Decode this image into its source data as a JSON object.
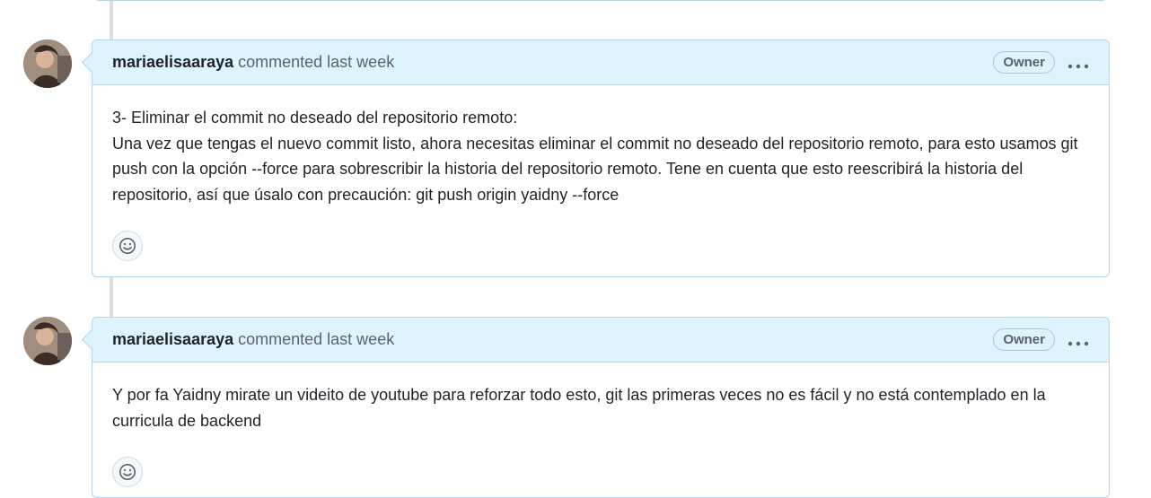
{
  "comments": [
    {
      "author": "mariaelisaaraya",
      "meta": "commented last week",
      "badge": "Owner",
      "menu_icon": "kebab-horizontal-icon",
      "body_lines": [
        "3- Eliminar el commit no deseado del repositorio remoto:",
        "Una vez que tengas el nuevo commit listo, ahora necesitas eliminar el commit no deseado del repositorio remoto, para esto usamos git push con la opción --force para sobrescribir la historia del repositorio remoto. Tene en cuenta que esto reescribirá la historia del repositorio, así que úsalo con precaución: git push origin yaidny --force"
      ],
      "reaction_icon": "smiley-icon"
    },
    {
      "author": "mariaelisaaraya",
      "meta": "commented last week",
      "badge": "Owner",
      "menu_icon": "kebab-horizontal-icon",
      "body_lines": [
        "Y por fa Yaidny mirate un videito de youtube para reforzar todo esto, git las primeras veces no es fácil y no está contemplado en la curricula de backend"
      ],
      "reaction_icon": "smiley-icon"
    }
  ],
  "colors": {
    "header_bg": "#ddf4ff",
    "border": "#b6d4ee",
    "timeline": "#d8dee4"
  }
}
